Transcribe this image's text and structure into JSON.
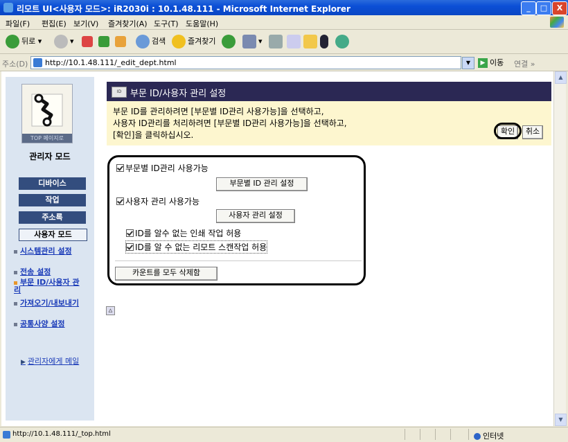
{
  "window": {
    "title": "리모트 UI<사용자 모드>: iR2030i : 10.1.48.111 - Microsoft Internet Explorer",
    "min": "_",
    "max": "□",
    "close": "X"
  },
  "menu": [
    "파일(F)",
    "편집(E)",
    "보기(V)",
    "즐겨찾기(A)",
    "도구(T)",
    "도움말(H)"
  ],
  "toolbar": {
    "back": "뒤로",
    "search": "검색",
    "favorites": "즐겨찾기"
  },
  "address": {
    "label": "주소(D)",
    "url": "http://10.1.48.111/_edit_dept.html",
    "go": "이동",
    "links": "연결 »"
  },
  "sidebar": {
    "logo_caption": "TOP 페이지로",
    "mode_title": "관리자 모드",
    "nav": [
      "디바이스",
      "작업",
      "주소록",
      "사용자 모드"
    ],
    "subs": [
      "시스템관리 설정",
      "전송 설정",
      "부문 ID/사용자 관리",
      "가져오기/내보내기",
      "공통사양 설정"
    ],
    "mail": "관리자에게 메일"
  },
  "header": {
    "icon_text": "ID",
    "title": "부문 ID/사용자 관리 설정"
  },
  "info": {
    "line1": "부문 ID를 관리하려면 [부문별 ID관리 사용가능]을 선택하고,",
    "line2": "사용자 ID관리를 처리하려면 [부문별 ID관리 사용가능]을 선택하고,",
    "line3": "[확인]을 클릭하십시오.",
    "ok": "확인",
    "cancel": "취소"
  },
  "form": {
    "dept_enable": "부문별 ID관리 사용가능",
    "dept_settings": "부문별 ID 관리 설정",
    "user_enable": "사용자 관리 사용가능",
    "user_settings": "사용자 관리 설정",
    "allow_print": "ID를 알수 없는 인쇄 작업 허용",
    "allow_scan": "ID를 알 수 없는 리모트 스캔작업 허용",
    "clear_counts": "카운트를 모두 삭제함"
  },
  "top_link": "△",
  "status": {
    "url": "http://10.1.48.111/_top.html",
    "zone": "인터넷"
  }
}
